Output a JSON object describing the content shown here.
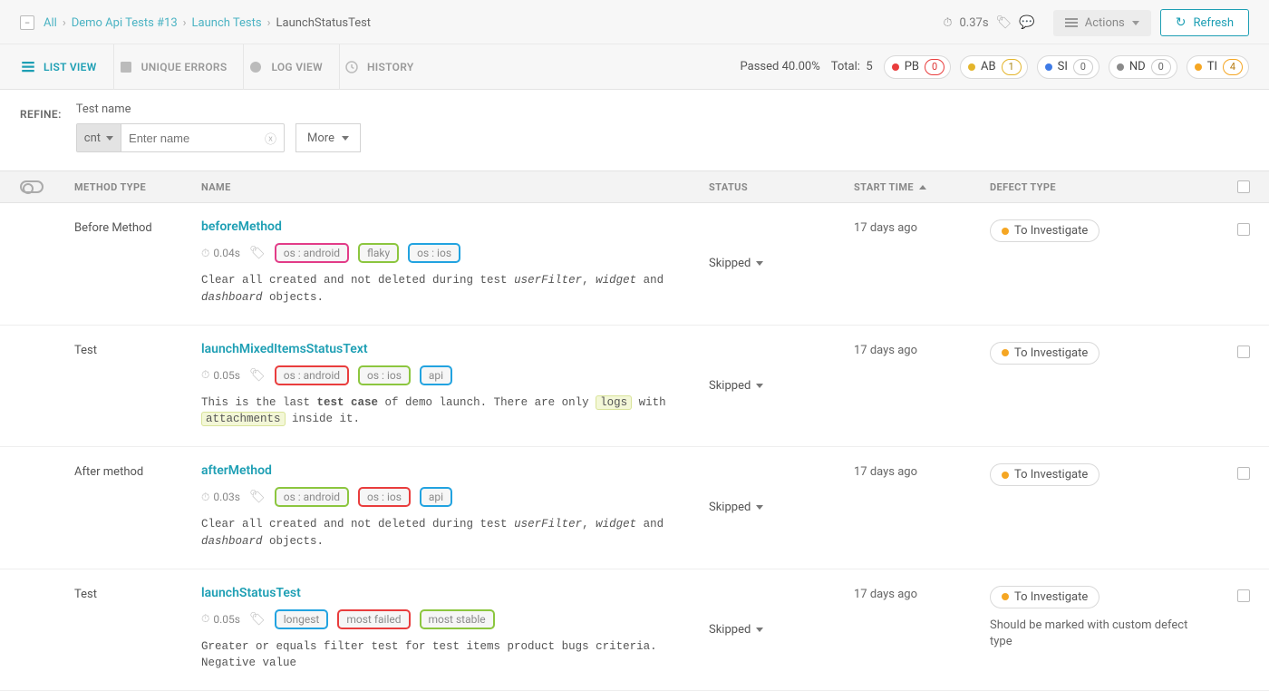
{
  "topbar": {
    "breadcrumb": [
      "All",
      "Demo Api Tests #13",
      "Launch Tests",
      "LaunchStatusTest"
    ],
    "duration": "0.37s",
    "actions_label": "Actions",
    "refresh_label": "Refresh"
  },
  "tabs": {
    "list_view": "LIST VIEW",
    "unique_errors": "UNIQUE ERRORS",
    "log_view": "LOG VIEW",
    "history": "HISTORY"
  },
  "stats": {
    "passed_label": "Passed 40.00%",
    "total_label": "Total:",
    "total_value": "5",
    "pills": [
      {
        "code": "PB",
        "count": "0",
        "dotClass": "dot-red",
        "pillClass": "pill-pb"
      },
      {
        "code": "AB",
        "count": "1",
        "dotClass": "dot-yellow",
        "pillClass": "pill-ab"
      },
      {
        "code": "SI",
        "count": "0",
        "dotClass": "dot-blue",
        "pillClass": ""
      },
      {
        "code": "ND",
        "count": "0",
        "dotClass": "dot-gray",
        "pillClass": ""
      },
      {
        "code": "TI",
        "count": "4",
        "dotClass": "dot-orange",
        "pillClass": "pill-ti"
      }
    ]
  },
  "refine": {
    "label": "REFINE:",
    "field_title": "Test name",
    "operator": "cnt",
    "placeholder": "Enter name",
    "more": "More"
  },
  "columns": {
    "method": "METHOD TYPE",
    "name": "NAME",
    "status": "STATUS",
    "start": "START TIME",
    "defect": "DEFECT TYPE"
  },
  "rows": [
    {
      "method": "Before Method",
      "name": "beforeMethod",
      "duration": "0.04s",
      "tags": [
        {
          "text": "os : android",
          "cls": "bd-pink"
        },
        {
          "text": "flaky",
          "cls": "bd-green"
        },
        {
          "text": "os : ios",
          "cls": "bd-blue"
        }
      ],
      "descHtml": "Clear all created and not deleted during test <span class='ital'>userFilter</span>, <span class='ital'>widget</span> and <span class='ital'>dashboard</span> objects.",
      "status": "Skipped",
      "start": "17 days ago",
      "defect": "To Investigate",
      "defectNote": ""
    },
    {
      "method": "Test",
      "name": "launchMixedItemsStatusText",
      "duration": "0.05s",
      "tags": [
        {
          "text": "os : android",
          "cls": "bd-red"
        },
        {
          "text": "os : ios",
          "cls": "bd-green"
        },
        {
          "text": "api",
          "cls": "bd-blue"
        }
      ],
      "descHtml": "This is the last <span class='bold'>test case</span> of demo launch. There are only <span class='chip-lite'>logs</span> with <span class='chip-lite'>attachments</span> inside it.",
      "status": "Skipped",
      "start": "17 days ago",
      "defect": "To Investigate",
      "defectNote": ""
    },
    {
      "method": "After method",
      "name": "afterMethod",
      "duration": "0.03s",
      "tags": [
        {
          "text": "os : android",
          "cls": "bd-green"
        },
        {
          "text": "os : ios",
          "cls": "bd-red"
        },
        {
          "text": "api",
          "cls": "bd-blue"
        }
      ],
      "descHtml": "Clear all created and not deleted during test <span class='ital'>userFilter</span>, <span class='ital'>widget</span> and <span class='ital'>dashboard</span> objects.",
      "status": "Skipped",
      "start": "17 days ago",
      "defect": "To Investigate",
      "defectNote": ""
    },
    {
      "method": "Test",
      "name": "launchStatusTest",
      "duration": "0.05s",
      "tags": [
        {
          "text": "longest",
          "cls": "bd-blue"
        },
        {
          "text": "most failed",
          "cls": "bd-red"
        },
        {
          "text": "most stable",
          "cls": "bd-green"
        }
      ],
      "descHtml": "Greater or equals filter test for test items product bugs criteria. Negative value",
      "status": "Skipped",
      "start": "17 days ago",
      "defect": "To Investigate",
      "defectNote": "Should be marked with custom defect type"
    }
  ]
}
